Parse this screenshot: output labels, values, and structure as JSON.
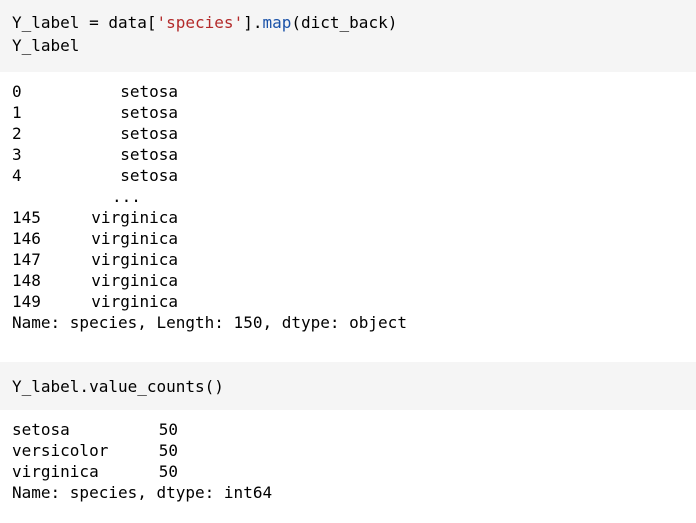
{
  "cell1": {
    "code_line1": {
      "a": "Y_label = data[",
      "str": "'species'",
      "b": "].",
      "fn": "map",
      "c": "(dict_back)"
    },
    "code_line2": "Y_label",
    "output": {
      "head_rows": [
        {
          "index": "0",
          "value": "setosa"
        },
        {
          "index": "1",
          "value": "setosa"
        },
        {
          "index": "2",
          "value": "setosa"
        },
        {
          "index": "3",
          "value": "setosa"
        },
        {
          "index": "4",
          "value": "setosa"
        }
      ],
      "ellipsis": "...",
      "tail_rows": [
        {
          "index": "145",
          "value": "virginica"
        },
        {
          "index": "146",
          "value": "virginica"
        },
        {
          "index": "147",
          "value": "virginica"
        },
        {
          "index": "148",
          "value": "virginica"
        },
        {
          "index": "149",
          "value": "virginica"
        }
      ],
      "footer": "Name: species, Length: 150, dtype: object"
    }
  },
  "cell2": {
    "code_line1": "Y_label.value_counts()",
    "output": {
      "rows": [
        {
          "category": "setosa",
          "count": "50"
        },
        {
          "category": "versicolor",
          "count": "50"
        },
        {
          "category": "virginica",
          "count": "50"
        }
      ],
      "footer": "Name: species, dtype: int64"
    }
  },
  "colors": {
    "input_background": "#f5f5f5",
    "string_literal": "#b32a2a",
    "function_name": "#1a52a8"
  }
}
